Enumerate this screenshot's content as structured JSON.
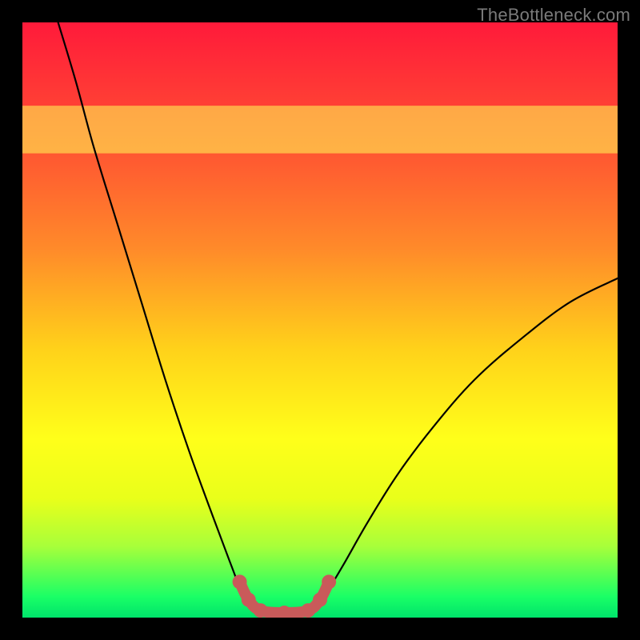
{
  "watermark": "TheBottleneck.com",
  "chart_data": {
    "type": "line",
    "title": "",
    "xlabel": "",
    "ylabel": "",
    "xlim": [
      0,
      100
    ],
    "ylim": [
      0,
      100
    ],
    "background_gradient": {
      "stops": [
        {
          "offset": 0.0,
          "color": "#ff1a3a"
        },
        {
          "offset": 0.18,
          "color": "#ff4a33"
        },
        {
          "offset": 0.38,
          "color": "#ff8a2a"
        },
        {
          "offset": 0.55,
          "color": "#ffd21a"
        },
        {
          "offset": 0.7,
          "color": "#ffff1a"
        },
        {
          "offset": 0.8,
          "color": "#e9ff1a"
        },
        {
          "offset": 0.88,
          "color": "#a8ff3a"
        },
        {
          "offset": 0.965,
          "color": "#1aff66"
        },
        {
          "offset": 1.0,
          "color": "#00e36b"
        }
      ]
    },
    "yellow_band": {
      "y0": 78,
      "y1": 86,
      "color": "#ffff55",
      "opacity": 0.55
    },
    "series": [
      {
        "name": "bottleneck-curve",
        "stroke": "#000000",
        "stroke_width": 2.2,
        "points": [
          {
            "x": 6,
            "y": 100
          },
          {
            "x": 9,
            "y": 90
          },
          {
            "x": 12,
            "y": 79
          },
          {
            "x": 16,
            "y": 66
          },
          {
            "x": 20,
            "y": 53
          },
          {
            "x": 24,
            "y": 40
          },
          {
            "x": 28,
            "y": 28
          },
          {
            "x": 32,
            "y": 17
          },
          {
            "x": 35,
            "y": 9
          },
          {
            "x": 37,
            "y": 4
          },
          {
            "x": 39,
            "y": 1
          },
          {
            "x": 41,
            "y": 0.5
          },
          {
            "x": 44,
            "y": 0.5
          },
          {
            "x": 47,
            "y": 0.5
          },
          {
            "x": 49,
            "y": 1
          },
          {
            "x": 51,
            "y": 4
          },
          {
            "x": 54,
            "y": 9
          },
          {
            "x": 58,
            "y": 16
          },
          {
            "x": 63,
            "y": 24
          },
          {
            "x": 69,
            "y": 32
          },
          {
            "x": 76,
            "y": 40
          },
          {
            "x": 84,
            "y": 47
          },
          {
            "x": 92,
            "y": 53
          },
          {
            "x": 100,
            "y": 57
          }
        ]
      }
    ],
    "highlight": {
      "name": "bottom-bracket",
      "stroke": "#c95a5a",
      "stroke_width": 14,
      "dot_radius": 9,
      "points": [
        {
          "x": 36.5,
          "y": 6
        },
        {
          "x": 38,
          "y": 3
        },
        {
          "x": 40,
          "y": 1.2
        },
        {
          "x": 44,
          "y": 0.8
        },
        {
          "x": 48,
          "y": 1.2
        },
        {
          "x": 50,
          "y": 3
        },
        {
          "x": 51.5,
          "y": 6
        }
      ]
    }
  }
}
